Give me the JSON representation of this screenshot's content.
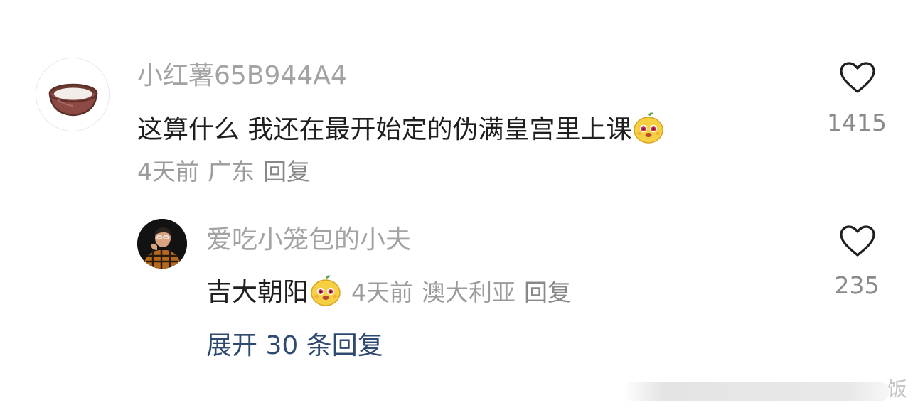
{
  "comment": {
    "username": "小红薯65B944A4",
    "text": "这算什么 我还在最开始定的伪满皇宫里上课",
    "time": "4天前",
    "location": "广东",
    "reply_label": "回复",
    "like_count": "1415"
  },
  "reply": {
    "username": "爱吃小笼包的小夫",
    "text": "吉大朝阳",
    "time": "4天前",
    "location": "澳大利亚",
    "reply_label": "回复",
    "like_count": "235"
  },
  "expand": {
    "label": "展开 30 条回复"
  },
  "watermark": {
    "glyph": "饭"
  },
  "colors": {
    "username": "#a3a3a3",
    "comment_text": "#1f1f1f",
    "meta": "#9b9b9b",
    "expand_link": "#2f4a70"
  },
  "icons": {
    "like": "heart-outline-icon",
    "sticker": "smiling-mascot-sticker"
  }
}
